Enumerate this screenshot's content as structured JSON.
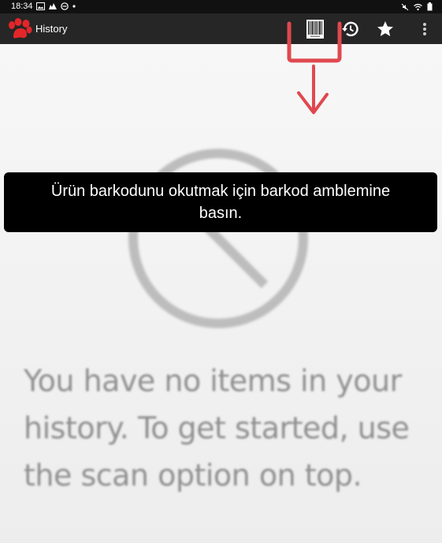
{
  "status_bar": {
    "time": "18:34",
    "left_icons": [
      "image-icon",
      "camera-icon",
      "do-not-disturb-icon",
      "dot-icon"
    ],
    "right_icons": [
      "mute-icon",
      "wifi-icon",
      "battery-icon"
    ]
  },
  "app_bar": {
    "title": "History",
    "logo_icon": "paw-logo",
    "logo_color": "#e3262a",
    "actions": [
      {
        "name": "scan",
        "icon": "barcode-icon"
      },
      {
        "name": "history",
        "icon": "history-icon"
      },
      {
        "name": "favorites",
        "icon": "star-icon"
      },
      {
        "name": "menu",
        "icon": "more-vert-icon"
      }
    ]
  },
  "empty_state": {
    "icon": "no-entry-icon",
    "message": "You have no items in your history. To get started, use the scan option on top."
  },
  "toast": {
    "text": "Ürün barkodunu okutmak için barkod amblemine basın."
  },
  "annotation": {
    "color": "#e0484e",
    "shape": "bracket-with-down-arrow"
  }
}
